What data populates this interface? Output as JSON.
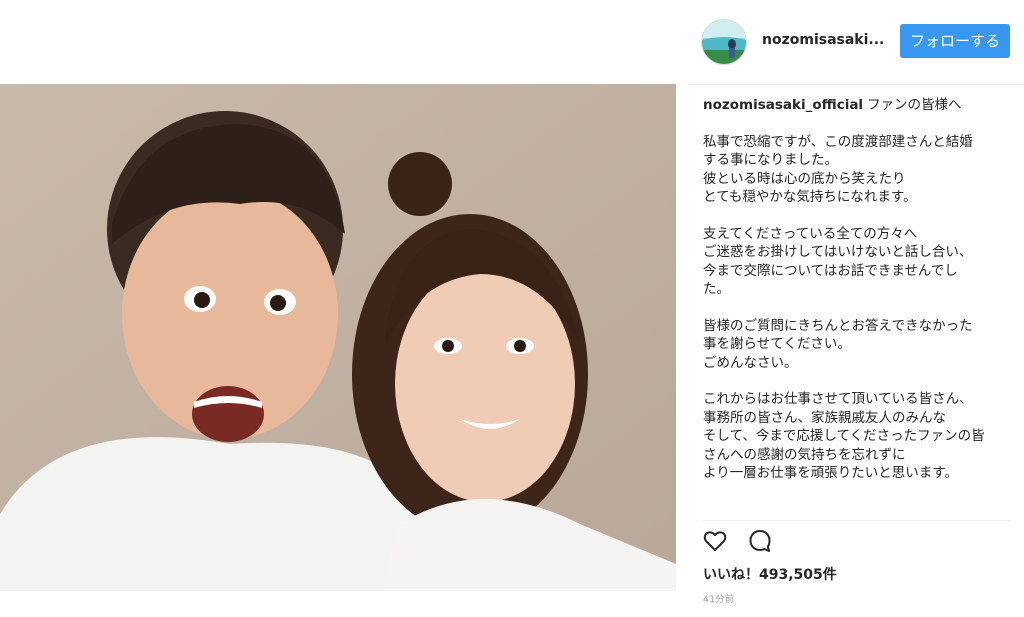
{
  "header": {
    "username": "nozomisasaki...",
    "follow_label": "フォローする",
    "avatar_icon": "profile-avatar"
  },
  "caption": {
    "username": "nozomisasaki_official",
    "first_line": "ファンの皆様へ",
    "paragraphs": [
      "私事で恐縮ですが、この度渡部建さんと結婚\nする事になりました。\n彼といる時は心の底から笑えたり\nとても穏やかな気持ちになれます。",
      "支えてくださっている全ての方々へ\nご迷惑をお掛けしてはいけないと話し合い、\n今まで交際についてはお話できませんでし\nた。",
      "皆様のご質問にきちんとお答えできなかった\n事を謝らせてください。\nごめんなさい。",
      "これからはお仕事させて頂いている皆さん、\n事務所の皆さん、家族親戚友人のみんな\nそして、今まで応援してくださったファンの皆\nさんへの感謝の気持ちを忘れずに\nより一層お仕事を頑張りたいと思います。"
    ]
  },
  "actions": {
    "like_icon": "heart-outline",
    "comment_icon": "speech-bubble-outline"
  },
  "likes_text": "いいね！493,505件",
  "timestamp": "41分前",
  "colors": {
    "follow_button": "#3897f0",
    "text": "#262626",
    "muted": "#999999"
  }
}
